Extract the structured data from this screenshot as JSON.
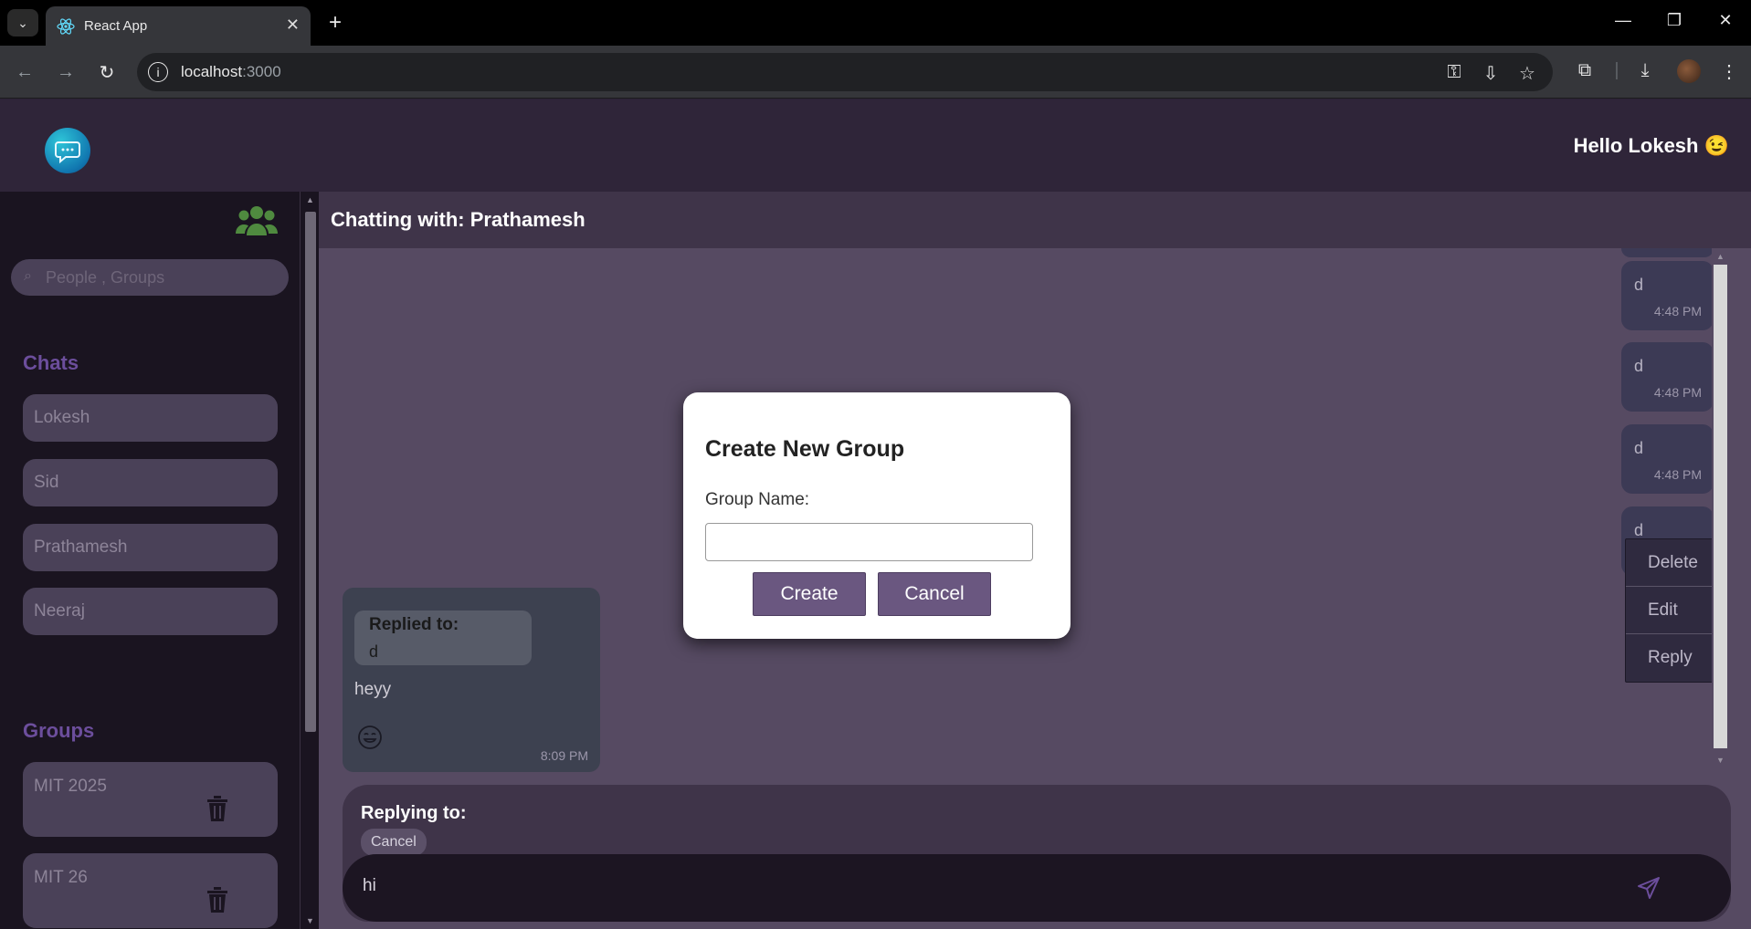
{
  "browser": {
    "tab_title": "React App",
    "url_host": "localhost",
    "url_port": ":3000"
  },
  "app": {
    "greeting": "Hello Lokesh 😉"
  },
  "sidebar": {
    "search_placeholder": "People , Groups",
    "chats_title": "Chats",
    "chats": [
      {
        "label": "Lokesh"
      },
      {
        "label": "Sid"
      },
      {
        "label": "Prathamesh"
      },
      {
        "label": "Neeraj"
      }
    ],
    "groups_title": "Groups",
    "groups": [
      {
        "label": "MIT 2025"
      },
      {
        "label": "MIT 26"
      }
    ]
  },
  "chat": {
    "header": "Chatting with: Prathamesh",
    "messages": [
      {
        "text": "d",
        "time": "4:48 PM"
      },
      {
        "text": "d",
        "time": "4:48 PM"
      },
      {
        "text": "d",
        "time": "4:48 PM"
      },
      {
        "text": "d",
        "time": ""
      }
    ],
    "context_menu": [
      "Delete",
      "Edit",
      "Reply"
    ],
    "reply_message": {
      "quote_label": "Replied to:",
      "quote_text": "d",
      "text": "heyy",
      "time": "8:09 PM"
    },
    "replying_label": "Replying to:",
    "replying_cancel": "Cancel",
    "composer_value": "hi"
  },
  "modal": {
    "title": "Create New Group",
    "field_label": "Group Name:",
    "field_value": "",
    "create_label": "Create",
    "cancel_label": "Cancel"
  },
  "colors": {
    "accent": "#6c4e9c",
    "button": "#6a5780",
    "bubble": "#3c3a55"
  }
}
